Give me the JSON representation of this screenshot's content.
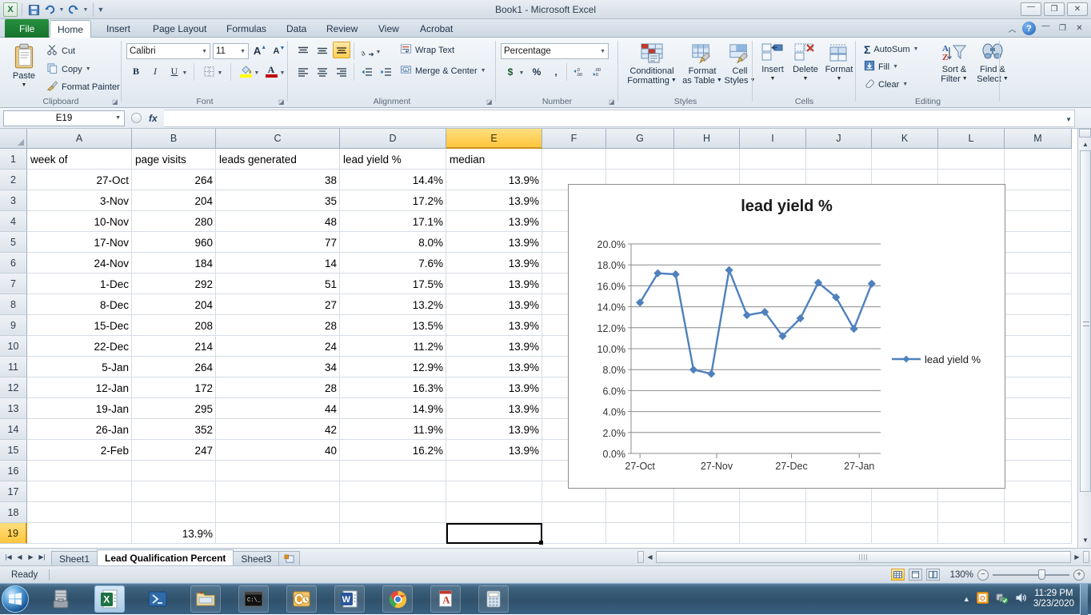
{
  "window": {
    "title": "Book1 - Microsoft Excel",
    "quick_access": [
      "save-icon",
      "undo-icon",
      "redo-icon",
      "customize-icon"
    ],
    "controls": {
      "minimize": "—",
      "restore": "❐",
      "close": "✕"
    }
  },
  "ribbon": {
    "tabs": [
      {
        "label": "File",
        "active": false
      },
      {
        "label": "Home",
        "active": true
      },
      {
        "label": "Insert",
        "active": false
      },
      {
        "label": "Page Layout",
        "active": false
      },
      {
        "label": "Formulas",
        "active": false
      },
      {
        "label": "Data",
        "active": false
      },
      {
        "label": "Review",
        "active": false
      },
      {
        "label": "View",
        "active": false
      },
      {
        "label": "Acrobat",
        "active": false
      }
    ],
    "groups": {
      "clipboard": {
        "label": "Clipboard",
        "paste": "Paste",
        "cut": "Cut",
        "copy": "Copy",
        "format_painter": "Format Painter"
      },
      "font": {
        "label": "Font",
        "font_name": "Calibri",
        "font_size": "11",
        "bold": "B",
        "italic": "I",
        "underline": "U",
        "grow": "A",
        "shrink": "A"
      },
      "alignment": {
        "label": "Alignment",
        "wrap_text": "Wrap Text",
        "merge_center": "Merge & Center"
      },
      "number": {
        "label": "Number",
        "format": "Percentage",
        "currency": "$",
        "percent": "%",
        "comma": ",",
        "increase_decimal": ".00",
        "decrease_decimal": ".00"
      },
      "styles": {
        "label": "Styles",
        "conditional_formatting": "Conditional\nFormatting",
        "conditional_formatting_l1": "Conditional",
        "conditional_formatting_l2": "Formatting",
        "format_as_table_l1": "Format",
        "format_as_table_l2": "as Table",
        "cell_styles_l1": "Cell",
        "cell_styles_l2": "Styles"
      },
      "cells": {
        "label": "Cells",
        "insert": "Insert",
        "delete": "Delete",
        "format": "Format"
      },
      "editing": {
        "label": "Editing",
        "autosum": "AutoSum",
        "fill": "Fill",
        "clear": "Clear",
        "sort_filter_l1": "Sort &",
        "sort_filter_l2": "Filter",
        "find_select_l1": "Find &",
        "find_select_l2": "Select"
      }
    }
  },
  "formula_bar": {
    "name_box": "E19",
    "formula": ""
  },
  "grid": {
    "columns": [
      "A",
      "B",
      "C",
      "D",
      "E",
      "F",
      "G",
      "H",
      "I",
      "J",
      "K",
      "L",
      "M"
    ],
    "selected_column": "E",
    "selected_row": "19",
    "rows": [
      "1",
      "2",
      "3",
      "4",
      "5",
      "6",
      "7",
      "8",
      "9",
      "10",
      "11",
      "12",
      "13",
      "14",
      "15",
      "16",
      "17",
      "18",
      "19"
    ],
    "headers": {
      "A": "week of",
      "B": "page visits",
      "C": "leads generated",
      "D": "lead yield %",
      "E": "median"
    },
    "data": [
      {
        "row": "2",
        "A": "27-Oct",
        "B": "264",
        "C": "38",
        "D": "14.4%",
        "E": "13.9%"
      },
      {
        "row": "3",
        "A": "3-Nov",
        "B": "204",
        "C": "35",
        "D": "17.2%",
        "E": "13.9%"
      },
      {
        "row": "4",
        "A": "10-Nov",
        "B": "280",
        "C": "48",
        "D": "17.1%",
        "E": "13.9%"
      },
      {
        "row": "5",
        "A": "17-Nov",
        "B": "960",
        "C": "77",
        "D": "8.0%",
        "E": "13.9%"
      },
      {
        "row": "6",
        "A": "24-Nov",
        "B": "184",
        "C": "14",
        "D": "7.6%",
        "E": "13.9%"
      },
      {
        "row": "7",
        "A": "1-Dec",
        "B": "292",
        "C": "51",
        "D": "17.5%",
        "E": "13.9%"
      },
      {
        "row": "8",
        "A": "8-Dec",
        "B": "204",
        "C": "27",
        "D": "13.2%",
        "E": "13.9%"
      },
      {
        "row": "9",
        "A": "15-Dec",
        "B": "208",
        "C": "28",
        "D": "13.5%",
        "E": "13.9%"
      },
      {
        "row": "10",
        "A": "22-Dec",
        "B": "214",
        "C": "24",
        "D": "11.2%",
        "E": "13.9%"
      },
      {
        "row": "11",
        "A": "5-Jan",
        "B": "264",
        "C": "34",
        "D": "12.9%",
        "E": "13.9%"
      },
      {
        "row": "12",
        "A": "12-Jan",
        "B": "172",
        "C": "28",
        "D": "16.3%",
        "E": "13.9%"
      },
      {
        "row": "13",
        "A": "19-Jan",
        "B": "295",
        "C": "44",
        "D": "14.9%",
        "E": "13.9%"
      },
      {
        "row": "14",
        "A": "26-Jan",
        "B": "352",
        "C": "42",
        "D": "11.9%",
        "E": "13.9%"
      },
      {
        "row": "15",
        "A": "2-Feb",
        "B": "247",
        "C": "40",
        "D": "16.2%",
        "E": "13.9%"
      },
      {
        "row": "16",
        "A": "",
        "B": "",
        "C": "",
        "D": "",
        "E": ""
      },
      {
        "row": "17",
        "A": "",
        "B": "",
        "C": "",
        "D": "",
        "E": ""
      },
      {
        "row": "18",
        "A": "",
        "B": "",
        "C": "",
        "D": "",
        "E": ""
      },
      {
        "row": "19",
        "A": "",
        "B": "13.9%",
        "C": "",
        "D": "",
        "E": ""
      }
    ]
  },
  "chart_data": {
    "type": "line",
    "title": "lead yield %",
    "xlabel": "",
    "ylabel": "",
    "ylim": [
      0,
      20
    ],
    "yticks": [
      "0.0%",
      "2.0%",
      "4.0%",
      "6.0%",
      "8.0%",
      "10.0%",
      "12.0%",
      "14.0%",
      "16.0%",
      "18.0%",
      "20.0%"
    ],
    "grid": true,
    "legend": [
      "lead yield %"
    ],
    "legend_position": "right",
    "x": [
      "27-Oct",
      "3-Nov",
      "10-Nov",
      "17-Nov",
      "24-Nov",
      "1-Dec",
      "8-Dec",
      "15-Dec",
      "22-Dec",
      "5-Jan",
      "12-Jan",
      "19-Jan",
      "26-Jan",
      "2-Feb"
    ],
    "xtick_labels": [
      "27-Oct",
      "27-Nov",
      "27-Dec",
      "27-Jan"
    ],
    "xtick_indices": [
      0,
      4.3,
      8.5,
      12.3
    ],
    "series": [
      {
        "name": "lead yield %",
        "values": [
          14.4,
          17.2,
          17.1,
          8.0,
          7.6,
          17.5,
          13.2,
          13.5,
          11.2,
          12.9,
          16.3,
          14.9,
          11.9,
          16.2
        ],
        "color": "#4f81bd"
      }
    ]
  },
  "sheet_tabs": {
    "items": [
      {
        "label": "Sheet1",
        "active": false
      },
      {
        "label": "Lead Qualification Percent",
        "active": true
      },
      {
        "label": "Sheet3",
        "active": false
      }
    ],
    "new_sheet": "new-sheet-icon"
  },
  "status_bar": {
    "message": "Ready",
    "zoom": "130%",
    "view_buttons": [
      "normal-view",
      "page-layout-view",
      "page-break-view"
    ]
  },
  "taskbar": {
    "items": [
      {
        "name": "start-orb",
        "active": false
      },
      {
        "name": "server-toolbox",
        "active": false
      },
      {
        "name": "excel",
        "active": true
      },
      {
        "name": "powershell",
        "active": false
      },
      {
        "name": "file-explorer",
        "active": false
      },
      {
        "name": "command-prompt",
        "active": false
      },
      {
        "name": "outlook",
        "active": false
      },
      {
        "name": "word",
        "active": false
      },
      {
        "name": "chrome",
        "active": false
      },
      {
        "name": "acrobat-reader",
        "active": false
      },
      {
        "name": "calculator",
        "active": false
      }
    ],
    "clock_time": "11:29 PM",
    "clock_date": "3/23/2020"
  },
  "colors": {
    "accent": "#4f81bd",
    "excel_green": "#1e7145",
    "selection_amber": "#ffc53d"
  }
}
